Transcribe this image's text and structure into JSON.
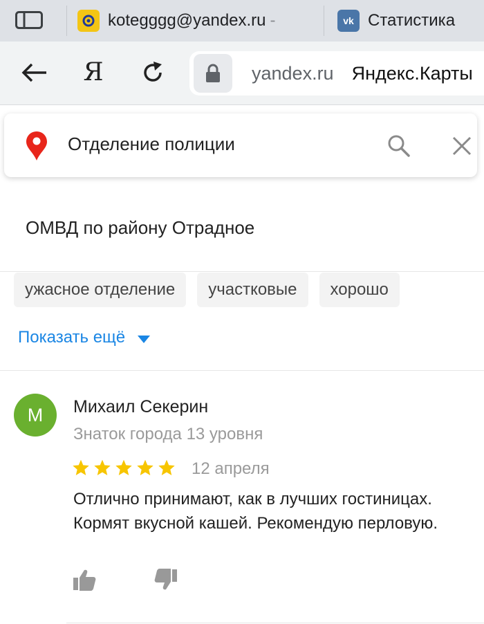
{
  "browser": {
    "tabs": [
      {
        "title": "kotegggg@yandex.ru",
        "favicon": "mail-icon",
        "trail": "-"
      },
      {
        "title": "Статистика",
        "favicon": "vk-icon"
      }
    ],
    "nav": {
      "logo": "Я"
    },
    "omnibox": {
      "domain": "yandex.ru",
      "title": "Яндекс.Карты"
    }
  },
  "search": {
    "query": "Отделение полиции"
  },
  "organization": {
    "name": "ОМВД по району Отрадное"
  },
  "tags": [
    "ужасное отделение",
    "участковые",
    "хорошо"
  ],
  "show_more_label": "Показать ещё",
  "review": {
    "avatar_letter": "М",
    "author": "Михаил Секерин",
    "level": "Знаток города 13 уровня",
    "rating": 5,
    "rating_max": 5,
    "date": "12 апреля",
    "text": "Отлично принимают, как в лучших гостиницах. Кормят вкусной кашей. Рекомендую перловую."
  },
  "colors": {
    "accent_link": "#1a86e4",
    "avatar_bg": "#6ab02f",
    "star": "#f7c500",
    "pin": "#e8261b"
  }
}
